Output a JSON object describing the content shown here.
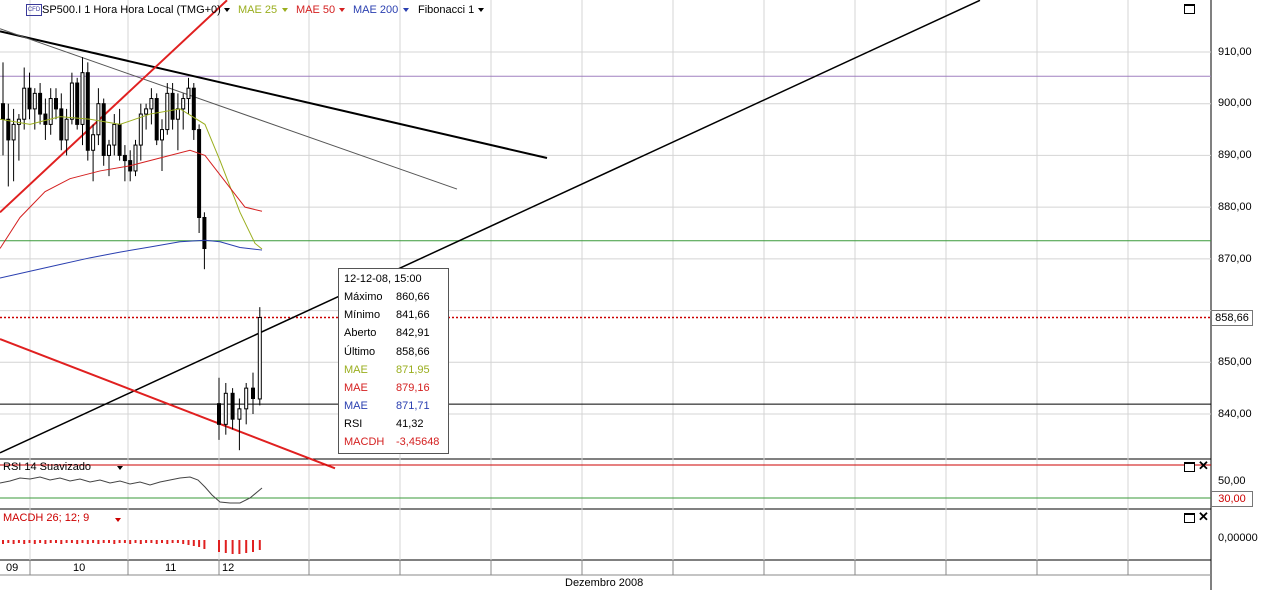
{
  "header": {
    "logo_text": "CFD",
    "symbol_label": "SP500.I 1 Hora Hora Local (TMG+0)",
    "indicators": [
      {
        "label": "MAE 25",
        "color": "#9aae1e"
      },
      {
        "label": "MAE 50",
        "color": "#d42020"
      },
      {
        "label": "MAE 200",
        "color": "#2a3fb0"
      },
      {
        "label": "Fibonacci 1",
        "color": "#000000"
      }
    ]
  },
  "tooltip": {
    "date": "12-12-08, 15:00",
    "rows": [
      {
        "label": "Máximo",
        "value": "860,66",
        "color": "#000000"
      },
      {
        "label": "Mínimo",
        "value": "841,66",
        "color": "#000000"
      },
      {
        "label": "Aberto",
        "value": "842,91",
        "color": "#000000"
      },
      {
        "label": "Último",
        "value": "858,66",
        "color": "#000000"
      },
      {
        "label": "MAE",
        "value": "871,95",
        "color": "#9aae1e"
      },
      {
        "label": "MAE",
        "value": "879,16",
        "color": "#d42020"
      },
      {
        "label": "MAE",
        "value": "871,71",
        "color": "#2a3fb0"
      },
      {
        "label": "RSI",
        "value": "41,32",
        "color": "#000000"
      },
      {
        "label": "MACDH",
        "value": "-3,45648",
        "color": "#d42020"
      }
    ]
  },
  "price_axis": {
    "ticks": [
      "910,00",
      "900,00",
      "890,00",
      "880,00",
      "870,00",
      "850,00",
      "840,00"
    ],
    "current_price": "858,66"
  },
  "rsi_panel": {
    "title": "RSI 14 Suavizado",
    "ticks": [
      "50,00"
    ],
    "level_box": "30,00"
  },
  "macd_panel": {
    "title": "MACDH 26; 12; 9",
    "ticks": [
      "0,00000"
    ]
  },
  "time_axis": {
    "day_labels": [
      "09",
      "10",
      "11",
      "12"
    ],
    "month_label": "Dezembro 2008"
  },
  "chart_data": {
    "type": "candlestick",
    "symbol": "SP500.I",
    "interval": "1 Hora",
    "y_range": [
      832,
      918
    ],
    "horizontal_levels": [
      {
        "value": 905.3,
        "color": "#a080c0"
      },
      {
        "value": 873.5,
        "color": "#3a9a3a"
      },
      {
        "value": 858.66,
        "color": "#cc0000",
        "style": "dotted"
      },
      {
        "value": 841.9,
        "color": "#000000"
      }
    ],
    "candles": [
      {
        "o": 900,
        "h": 908,
        "l": 890,
        "c": 897
      },
      {
        "o": 897,
        "h": 900,
        "l": 884,
        "c": 893
      },
      {
        "o": 893,
        "h": 899,
        "l": 885,
        "c": 896
      },
      {
        "o": 896,
        "h": 898,
        "l": 889,
        "c": 897
      },
      {
        "o": 897,
        "h": 907,
        "l": 895,
        "c": 903
      },
      {
        "o": 903,
        "h": 906,
        "l": 897,
        "c": 899
      },
      {
        "o": 899,
        "h": 903,
        "l": 895,
        "c": 902
      },
      {
        "o": 902,
        "h": 904,
        "l": 896,
        "c": 898
      },
      {
        "o": 898,
        "h": 901,
        "l": 893,
        "c": 896
      },
      {
        "o": 896,
        "h": 903,
        "l": 894,
        "c": 901
      },
      {
        "o": 901,
        "h": 903,
        "l": 897,
        "c": 899
      },
      {
        "o": 899,
        "h": 902,
        "l": 891,
        "c": 893
      },
      {
        "o": 893,
        "h": 899,
        "l": 890,
        "c": 897
      },
      {
        "o": 897,
        "h": 906,
        "l": 896,
        "c": 904
      },
      {
        "o": 904,
        "h": 905,
        "l": 895,
        "c": 896
      },
      {
        "o": 896,
        "h": 909,
        "l": 892,
        "c": 906
      },
      {
        "o": 906,
        "h": 908,
        "l": 889,
        "c": 891
      },
      {
        "o": 891,
        "h": 896,
        "l": 885,
        "c": 894
      },
      {
        "o": 894,
        "h": 903,
        "l": 892,
        "c": 900
      },
      {
        "o": 900,
        "h": 901,
        "l": 888,
        "c": 890
      },
      {
        "o": 890,
        "h": 893,
        "l": 886,
        "c": 892
      },
      {
        "o": 892,
        "h": 898,
        "l": 890,
        "c": 896
      },
      {
        "o": 896,
        "h": 899,
        "l": 889,
        "c": 890
      },
      {
        "o": 890,
        "h": 892,
        "l": 885,
        "c": 889
      },
      {
        "o": 889,
        "h": 891,
        "l": 885,
        "c": 887
      },
      {
        "o": 887,
        "h": 893,
        "l": 886,
        "c": 892
      },
      {
        "o": 892,
        "h": 900,
        "l": 889,
        "c": 898
      },
      {
        "o": 898,
        "h": 900,
        "l": 895,
        "c": 899
      },
      {
        "o": 899,
        "h": 903,
        "l": 896,
        "c": 901
      },
      {
        "o": 901,
        "h": 902,
        "l": 892,
        "c": 893
      },
      {
        "o": 893,
        "h": 897,
        "l": 887,
        "c": 895
      },
      {
        "o": 895,
        "h": 904,
        "l": 894,
        "c": 902
      },
      {
        "o": 902,
        "h": 904,
        "l": 895,
        "c": 897
      },
      {
        "o": 897,
        "h": 902,
        "l": 891,
        "c": 899
      },
      {
        "o": 899,
        "h": 902,
        "l": 895,
        "c": 901
      },
      {
        "o": 901,
        "h": 905,
        "l": 898,
        "c": 903
      },
      {
        "o": 903,
        "h": 904,
        "l": 893,
        "c": 895
      },
      {
        "o": 895,
        "h": 896,
        "l": 875,
        "c": 878
      },
      {
        "o": 878,
        "h": 879,
        "l": 868,
        "c": 872
      },
      {
        "o": 842,
        "h": 847,
        "l": 835,
        "c": 838
      },
      {
        "o": 838,
        "h": 846,
        "l": 836,
        "c": 844
      },
      {
        "o": 844,
        "h": 845,
        "l": 837,
        "c": 839
      },
      {
        "o": 839,
        "h": 843,
        "l": 833,
        "c": 841
      },
      {
        "o": 841,
        "h": 846,
        "l": 838,
        "c": 845
      },
      {
        "o": 845,
        "h": 848,
        "l": 840,
        "c": 843
      },
      {
        "o": 842.91,
        "h": 860.66,
        "l": 841.66,
        "c": 858.66
      }
    ]
  },
  "colors": {
    "grid": "#d4d4d4",
    "ma25": "#9aae1e",
    "ma50": "#d42020",
    "ma200": "#2a3fb0",
    "trend_black": "#000000",
    "trend_red": "#e02020"
  }
}
